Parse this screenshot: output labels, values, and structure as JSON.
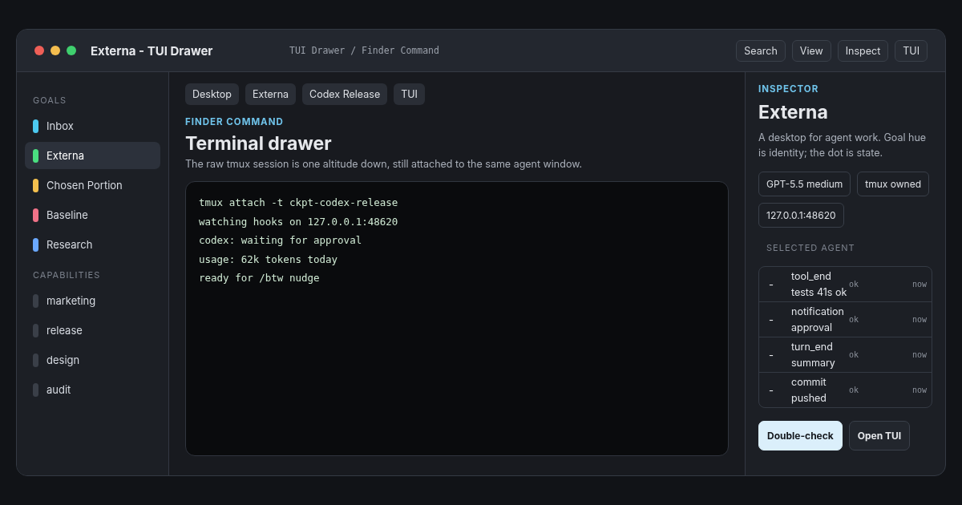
{
  "window": {
    "title": "Externa - TUI Drawer",
    "breadcrumb": "TUI Drawer / Finder Command",
    "toolbar": [
      "Search",
      "View",
      "Inspect",
      "TUI"
    ]
  },
  "sidebar": {
    "sections": [
      {
        "heading": "GOALS",
        "items": [
          {
            "label": "Inbox",
            "color": "#4cc9f0",
            "selected": false
          },
          {
            "label": "Externa",
            "color": "#4ade80",
            "selected": true
          },
          {
            "label": "Chosen Portion",
            "color": "#f4c04e",
            "selected": false
          },
          {
            "label": "Baseline",
            "color": "#f07288",
            "selected": false
          },
          {
            "label": "Research",
            "color": "#6aa8ff",
            "selected": false
          }
        ]
      },
      {
        "heading": "CAPABILITIES",
        "items": [
          {
            "label": "marketing",
            "color": "#3a3f48",
            "selected": false
          },
          {
            "label": "release",
            "color": "#3a3f48",
            "selected": false
          },
          {
            "label": "design",
            "color": "#3a3f48",
            "selected": false
          },
          {
            "label": "audit",
            "color": "#3a3f48",
            "selected": false
          }
        ]
      }
    ]
  },
  "main": {
    "chips": [
      "Desktop",
      "Externa",
      "Codex Release",
      "TUI"
    ],
    "eyebrow": "FINDER COMMAND",
    "title": "Terminal drawer",
    "description": "The raw tmux session is one altitude down, still attached to the same agent window.",
    "terminal": [
      "tmux attach -t ckpt-codex-release",
      "watching hooks on 127.0.0.1:48620",
      "codex: waiting for approval",
      "usage: 62k tokens today",
      "ready for /btw nudge"
    ]
  },
  "inspector": {
    "eyebrow": "INSPECTOR",
    "title": "Externa",
    "description": "A desktop for agent work. Goal hue is identity; the dot is state.",
    "tags": [
      "GPT-5.5 medium",
      "tmux owned",
      "127.0.0.1:48620"
    ],
    "section": "SELECTED AGENT",
    "events": [
      {
        "marker": "-",
        "text": "tool_end tests 41s ok",
        "status": "ok",
        "time": "now"
      },
      {
        "marker": "-",
        "text": "notification approval",
        "status": "ok",
        "time": "now"
      },
      {
        "marker": "-",
        "text": "turn_end summary",
        "status": "ok",
        "time": "now"
      },
      {
        "marker": "-",
        "text": "commit pushed",
        "status": "ok",
        "time": "now"
      }
    ],
    "buttons": [
      {
        "label": "Double-check",
        "kind": "primary"
      },
      {
        "label": "Open TUI",
        "kind": "secondary"
      }
    ]
  }
}
